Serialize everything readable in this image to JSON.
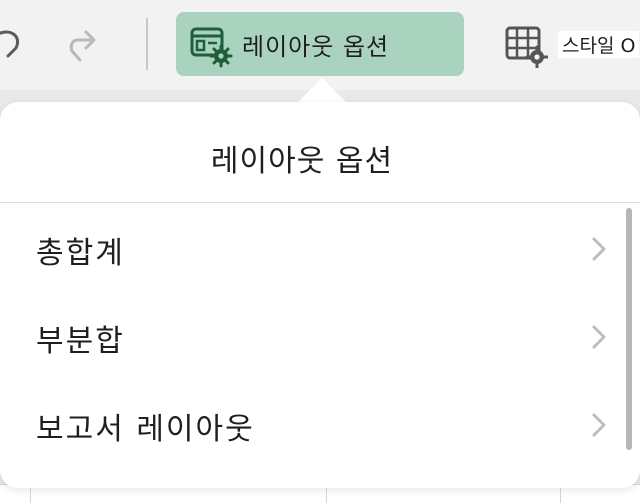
{
  "toolbar": {
    "undo_icon": "undo-icon",
    "redo_icon": "redo-icon",
    "layout_button": {
      "icon": "layout-options-icon",
      "label": "레이아웃 옵션",
      "active_color": "#a9d3bf"
    },
    "style_button": {
      "icon": "table-style-icon",
      "label": "스타일 O"
    }
  },
  "popover": {
    "title": "레이아웃 옵션",
    "items": [
      {
        "label": "총합계",
        "icon": "chevron-right-icon"
      },
      {
        "label": "부분합",
        "icon": "chevron-right-icon"
      },
      {
        "label": "보고서 레이아웃",
        "icon": "chevron-right-icon"
      }
    ]
  },
  "colors": {
    "accent_green": "#1e7145",
    "button_highlight": "#a9d3bf"
  }
}
